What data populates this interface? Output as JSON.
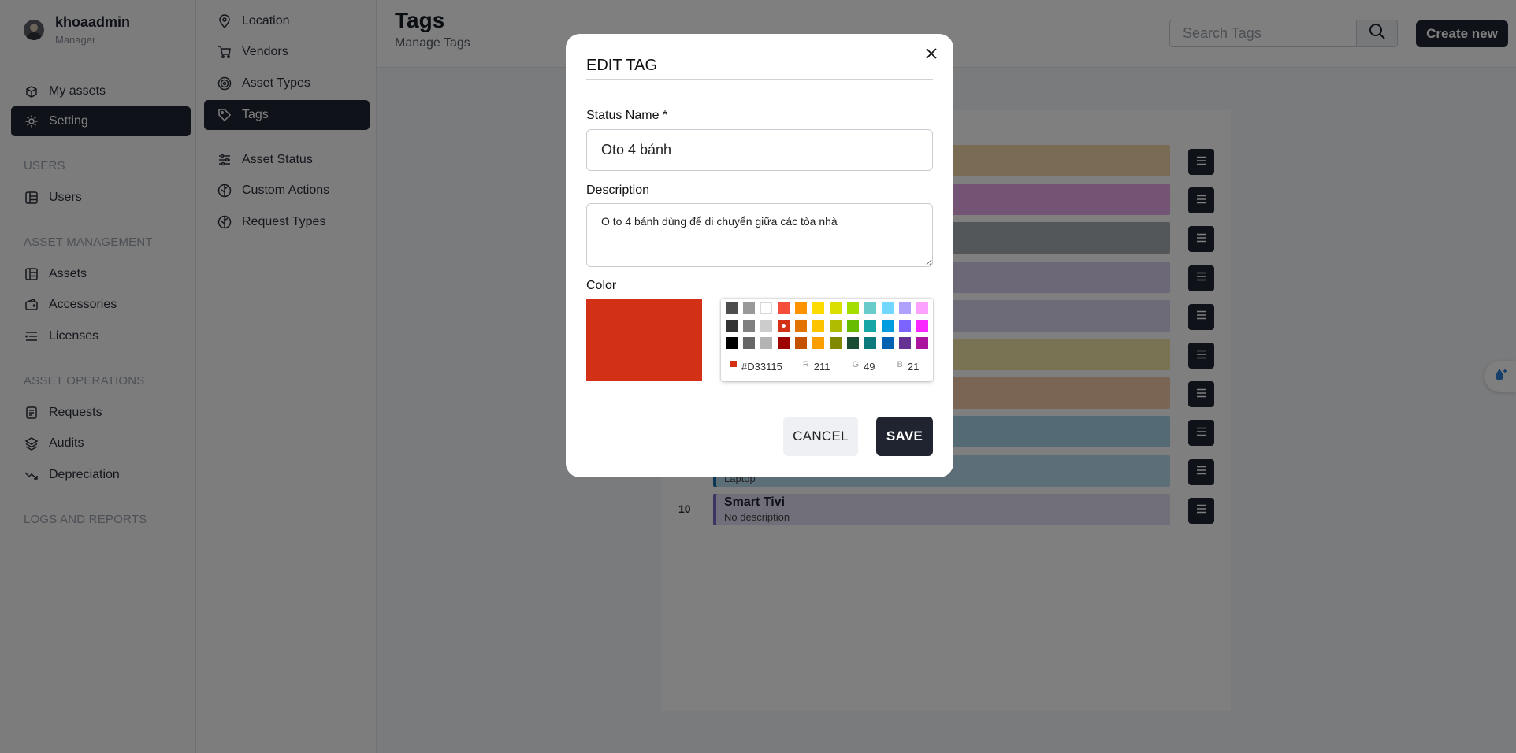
{
  "user": {
    "name": "khoaadmin",
    "role": "Manager"
  },
  "sidebar": {
    "items": [
      {
        "label": "My assets",
        "icon": "box-icon"
      },
      {
        "label": "Setting",
        "icon": "gear-icon",
        "active": true
      }
    ],
    "sections": [
      {
        "title": "USERS",
        "items": [
          {
            "label": "Users",
            "icon": "grid-icon"
          }
        ]
      },
      {
        "title": "ASSET MANAGEMENT",
        "items": [
          {
            "label": "Assets",
            "icon": "grid-icon"
          },
          {
            "label": "Accessories",
            "icon": "wallet-icon"
          },
          {
            "label": "Licenses",
            "icon": "list-icon"
          }
        ]
      },
      {
        "title": "ASSET OPERATIONS",
        "items": [
          {
            "label": "Requests",
            "icon": "clipboard-icon"
          },
          {
            "label": "Audits",
            "icon": "layers-icon"
          },
          {
            "label": "Depreciation",
            "icon": "trend-down-icon"
          }
        ]
      },
      {
        "title": "LOGS AND REPORTS",
        "items": []
      }
    ]
  },
  "subnav": {
    "items": [
      {
        "label": "Location",
        "icon": "location-pin-icon"
      },
      {
        "label": "Vendors",
        "icon": "cart-icon"
      },
      {
        "label": "Asset Types",
        "icon": "target-icon"
      },
      {
        "label": "Tags",
        "icon": "tag-icon",
        "active": true
      },
      {
        "label": "Asset Status",
        "icon": "sliders-icon"
      },
      {
        "label": "Custom Actions",
        "icon": "leaf-icon"
      },
      {
        "label": "Request Types",
        "icon": "leaf-icon"
      }
    ]
  },
  "header": {
    "title": "Tags",
    "subtitle": "Manage Tags",
    "search_placeholder": "Search Tags",
    "create_label": "Create new"
  },
  "tags_table": {
    "rows": [
      {
        "index": "",
        "name": "",
        "description": "",
        "color": "#f3d6a8"
      },
      {
        "index": "",
        "name": "",
        "description": "",
        "color": "#e6a8e8"
      },
      {
        "index": "",
        "name": "",
        "description": "",
        "color": "#a9aeb2"
      },
      {
        "index": "",
        "name": "",
        "description": "",
        "color": "#d8d0ee"
      },
      {
        "index": "",
        "name": "",
        "description": "",
        "color": "#d9d6ee"
      },
      {
        "index": "",
        "name": "",
        "description": "",
        "color": "#f2e5a6"
      },
      {
        "index": "",
        "name": "",
        "description": "",
        "color": "#f5c9a8"
      },
      {
        "index": "",
        "name": "",
        "description": "",
        "color": "#a9d4ea"
      },
      {
        "index": "",
        "name": "",
        "description": "Laptop",
        "color": "#b9dcee",
        "accent": "#1a6aa8"
      },
      {
        "index": "10",
        "name": "Smart Tivi",
        "description": "No description",
        "color": "#e2def2",
        "accent": "#7b68c8"
      }
    ]
  },
  "modal": {
    "title": "EDIT TAG",
    "status_name_label": "Status Name *",
    "status_name_value": "Oto 4 bánh",
    "description_label": "Description",
    "description_value": "O to 4 bánh dùng để di chuyển giữa các tòa nhà",
    "color_label": "Color",
    "selected_color": "#D33115",
    "hex_label": "#D33115",
    "rgb": {
      "r_label": "R",
      "r": "211",
      "g_label": "G",
      "g": "49",
      "b_label": "B",
      "b": "21"
    },
    "palette": [
      "#4D4D4D",
      "#999999",
      "#FFFFFF",
      "#F44E3B",
      "#FE9200",
      "#FCDC00",
      "#DBDF00",
      "#A4DD00",
      "#68CCCA",
      "#73D8FF",
      "#AEA1FF",
      "#FDA1FF",
      "#333333",
      "#808080",
      "#CCCCCC",
      "#D33115",
      "#E27300",
      "#FCC400",
      "#B0BC00",
      "#68BC00",
      "#16A5A5",
      "#009CE0",
      "#7B64FF",
      "#FA28FF",
      "#000000",
      "#666666",
      "#B3B3B3",
      "#9F0500",
      "#C45100",
      "#FB9E00",
      "#808900",
      "#194D33",
      "#0C797D",
      "#0062B1",
      "#653294",
      "#AB149E"
    ],
    "cancel_label": "CANCEL",
    "save_label": "SAVE"
  }
}
